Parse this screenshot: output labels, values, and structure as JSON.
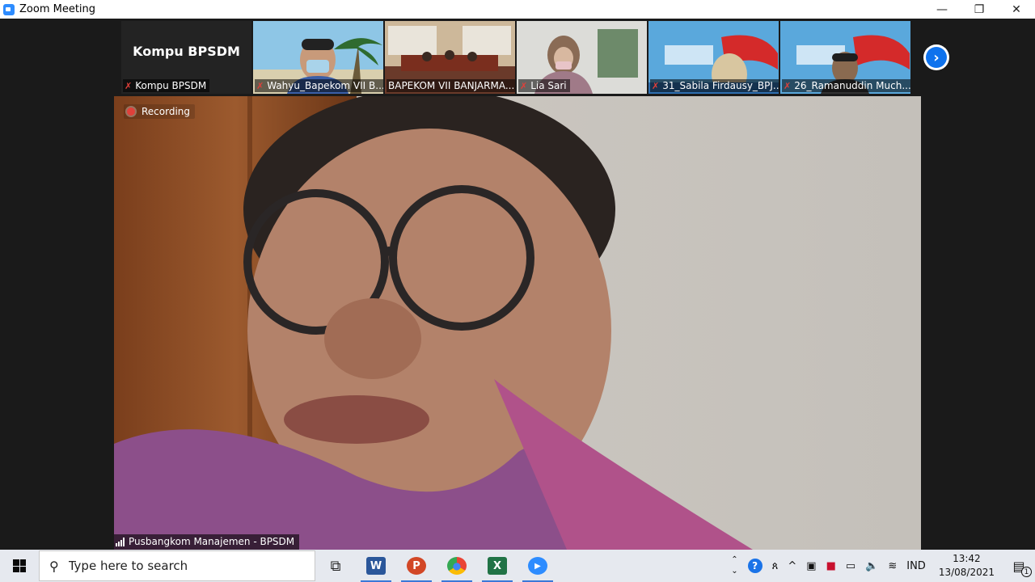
{
  "window": {
    "title": "Zoom Meeting",
    "minimize": "—",
    "restore": "❐",
    "close": "✕"
  },
  "gallery": {
    "tiles": [
      {
        "display_name": "Kompu BPSDM",
        "label": "Kompu BPSDM",
        "muted": true
      },
      {
        "label": "Wahyu_Bapekom VII B...",
        "muted": true
      },
      {
        "label": "BAPEKOM VII BANJARMA...",
        "muted": false
      },
      {
        "label": "Lia Sari",
        "muted": true
      },
      {
        "label": "31_Sabila Firdausy_BPJ...",
        "muted": true
      },
      {
        "label": "26_Ramanuddin Much...",
        "muted": true
      }
    ],
    "next_icon": "›"
  },
  "main_video": {
    "recording_label": "Recording",
    "speaker_name": "Pusbangkom Manajemen - BPSDM"
  },
  "taskbar": {
    "search_placeholder": "Type here to search",
    "apps": [
      {
        "name": "task-view",
        "glyph": "⧉"
      },
      {
        "name": "word",
        "glyph": "W",
        "color": "#2b579a"
      },
      {
        "name": "powerpoint",
        "glyph": "P",
        "color": "#d24726"
      },
      {
        "name": "chrome",
        "glyph": "●",
        "color": "#34a853"
      },
      {
        "name": "excel",
        "glyph": "X",
        "color": "#217346"
      },
      {
        "name": "zoom",
        "glyph": "▶",
        "color": "#2d8cff"
      }
    ],
    "tray": {
      "help": "?",
      "people": "ጰ",
      "chevron": "^",
      "language": "IND",
      "time": "13:42",
      "date": "13/08/2021",
      "notifications": "1"
    }
  },
  "colors": {
    "accent": "#0e72ed",
    "mic_off": "#e0403a",
    "recording": "#e0403a"
  }
}
